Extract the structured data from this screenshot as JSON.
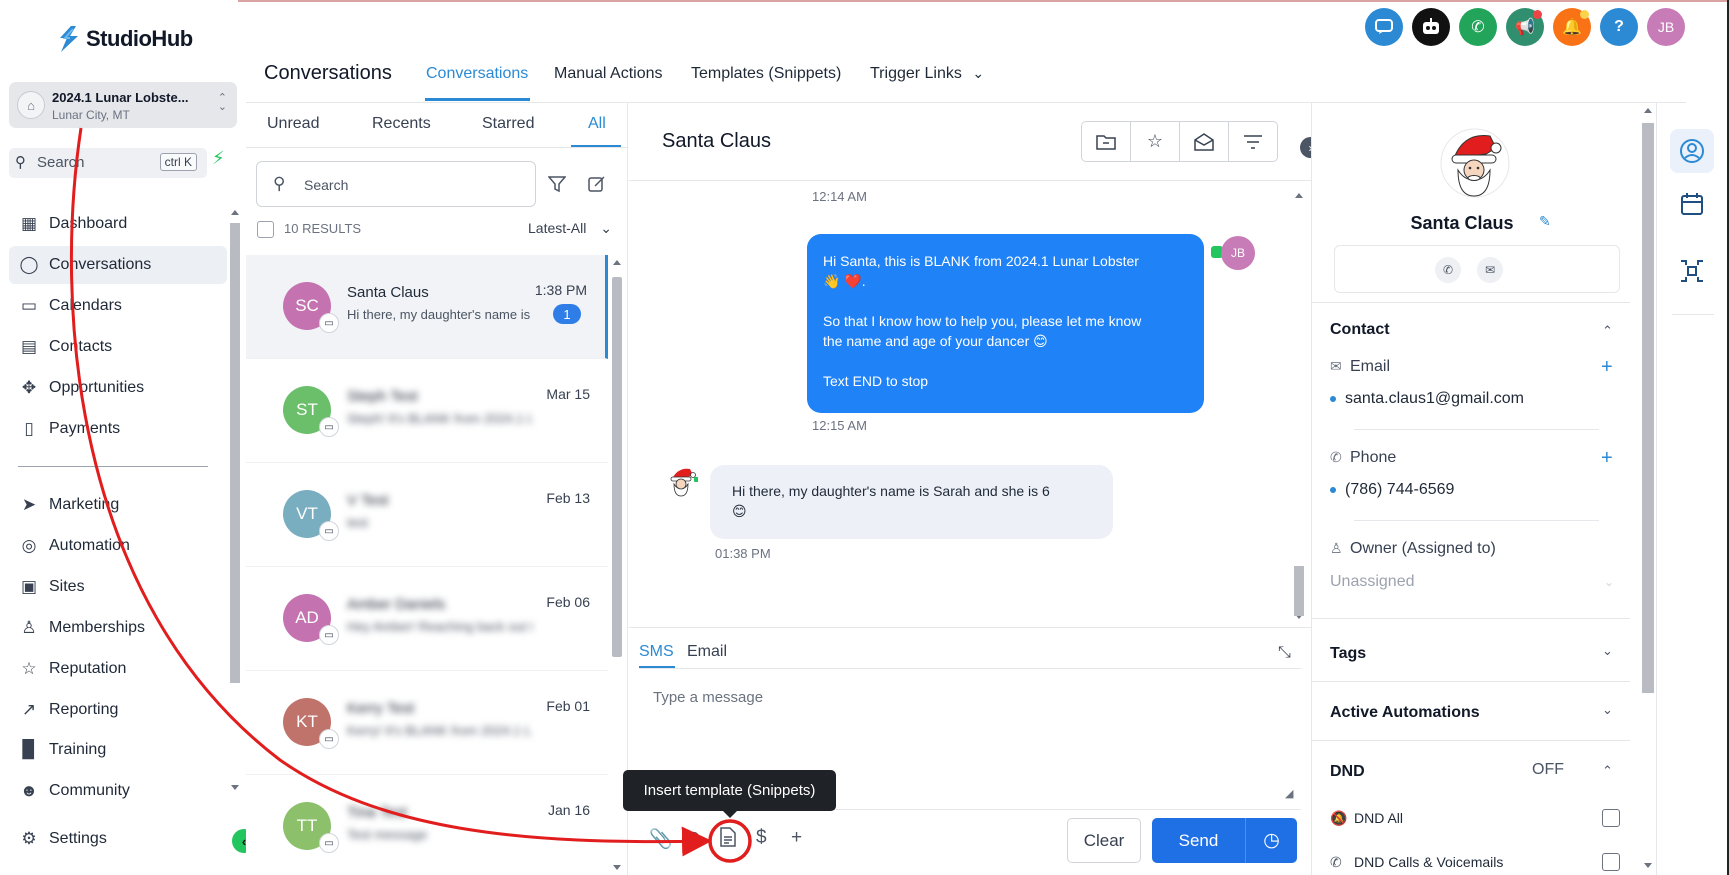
{
  "app": {
    "brand": "StudioHub"
  },
  "topbar": {
    "icons": [
      {
        "name": "chat-widget-icon",
        "color": "#2b8ad3"
      },
      {
        "name": "bot-icon",
        "color": "#111111"
      },
      {
        "name": "phone-icon",
        "color": "#22a55a"
      },
      {
        "name": "megaphone-icon",
        "color": "#2f8f6f"
      },
      {
        "name": "bell-icon",
        "color": "#f97316"
      },
      {
        "name": "help-icon",
        "color": "#2b8ad3"
      },
      {
        "name": "user-avatar",
        "color": "#c77bb7"
      }
    ],
    "help_label": "?",
    "avatar_initials": "JB"
  },
  "sidebar": {
    "location_name": "2024.1 Lunar Lobste...",
    "location_sub": "Lunar City, MT",
    "search_label": "Search",
    "search_shortcut": "ctrl K",
    "items": [
      {
        "label": "Dashboard",
        "icon": "dashboard-icon",
        "glyph": "▦"
      },
      {
        "label": "Conversations",
        "icon": "chat-icon",
        "glyph": "◯",
        "active": true
      },
      {
        "label": "Calendars",
        "icon": "calendar-icon",
        "glyph": "▭"
      },
      {
        "label": "Contacts",
        "icon": "contacts-icon",
        "glyph": "▤"
      },
      {
        "label": "Opportunities",
        "icon": "opportunities-icon",
        "glyph": "✥"
      },
      {
        "label": "Payments",
        "icon": "payments-icon",
        "glyph": "▯"
      },
      {
        "label": "Marketing",
        "icon": "send-icon",
        "glyph": "➤"
      },
      {
        "label": "Automation",
        "icon": "automation-icon",
        "glyph": "◎"
      },
      {
        "label": "Sites",
        "icon": "sites-icon",
        "glyph": "▣"
      },
      {
        "label": "Memberships",
        "icon": "memberships-icon",
        "glyph": "♙"
      },
      {
        "label": "Reputation",
        "icon": "star-icon",
        "glyph": "☆"
      },
      {
        "label": "Reporting",
        "icon": "reporting-icon",
        "glyph": "↗"
      },
      {
        "label": "Training",
        "icon": "book-icon",
        "glyph": "▉"
      },
      {
        "label": "Community",
        "icon": "community-icon",
        "glyph": "☻"
      }
    ],
    "settings_label": "Settings"
  },
  "header": {
    "title": "Conversations",
    "tabs": [
      {
        "label": "Conversations",
        "active": true
      },
      {
        "label": "Manual Actions"
      },
      {
        "label": "Templates (Snippets)"
      },
      {
        "label": "Trigger Links"
      }
    ],
    "trigger_chevron": "⌄"
  },
  "list": {
    "tabs": [
      "Unread",
      "Recents",
      "Starred",
      "All"
    ],
    "active_tab": "All",
    "search_placeholder": "Search",
    "results_label": "10 RESULTS",
    "sort_label": "Latest-All",
    "conversations": [
      {
        "initials": "SC",
        "name": "Santa Claus",
        "preview": "Hi there, my daughter's name is",
        "time": "1:38 PM",
        "unread": "1",
        "color": "#c472b0",
        "selected": true
      },
      {
        "initials": "ST",
        "name": "Steph Test",
        "preview": "Steph! It's BLANK from 2024.1 Lu",
        "time": "Mar 15",
        "color": "#6bbf6b",
        "blurred": true
      },
      {
        "initials": "VT",
        "name": "V Test",
        "preview": "test",
        "time": "Feb 13",
        "color": "#79aec0",
        "blurred": true
      },
      {
        "initials": "AD",
        "name": "Amber Daniels",
        "preview": "Hey Amber! Reaching back out t",
        "time": "Feb 06",
        "color": "#c472b0",
        "blurred": true
      },
      {
        "initials": "KT",
        "name": "Kerry Test",
        "preview": "Kerry! It's BLANK from 2024.1 Lu",
        "time": "Feb 01",
        "color": "#c0736b",
        "blurred": true
      },
      {
        "initials": "TT",
        "name": "Tina Test",
        "preview": "Test message",
        "time": "Jan 16",
        "color": "#8cc06b",
        "blurred": true
      }
    ]
  },
  "chat": {
    "title": "Santa Claus",
    "time_top": "12:14 AM",
    "outgoing_lines": [
      "Hi Santa, this is BLANK from 2024.1 Lunar Lobster",
      "👋 ❤️.",
      "",
      "So that I know how to help you, please let me know",
      "the name and age of your dancer 😊",
      "",
      "Text END to stop"
    ],
    "outgoing_time": "12:15 AM",
    "outgoing_avatar": "JB",
    "incoming_lines": [
      "Hi there, my daughter's name is Sarah and she is 6",
      "😊"
    ],
    "incoming_time": "01:38 PM",
    "composer_tabs": [
      "SMS",
      "Email"
    ],
    "composer_active": "SMS",
    "message_placeholder": "Type a message",
    "clear_label": "Clear",
    "send_label": "Send",
    "tooltip": "Insert template (Snippets)"
  },
  "contact": {
    "name": "Santa Claus",
    "section_contact": "Contact",
    "email_label": "Email",
    "email_value": "santa.claus1@gmail.com",
    "phone_label": "Phone",
    "phone_value": "(786) 744-6569",
    "owner_label": "Owner (Assigned to)",
    "owner_value": "Unassigned",
    "tags_label": "Tags",
    "automations_label": "Active Automations",
    "dnd_label": "DND",
    "dnd_status": "OFF",
    "dnd_all_label": "DND All",
    "dnd_calls_label": "DND Calls & Voicemails"
  },
  "colors": {
    "accent": "#2b8ad3",
    "send": "#1f6fe5",
    "annotation": "#e11d1d"
  }
}
